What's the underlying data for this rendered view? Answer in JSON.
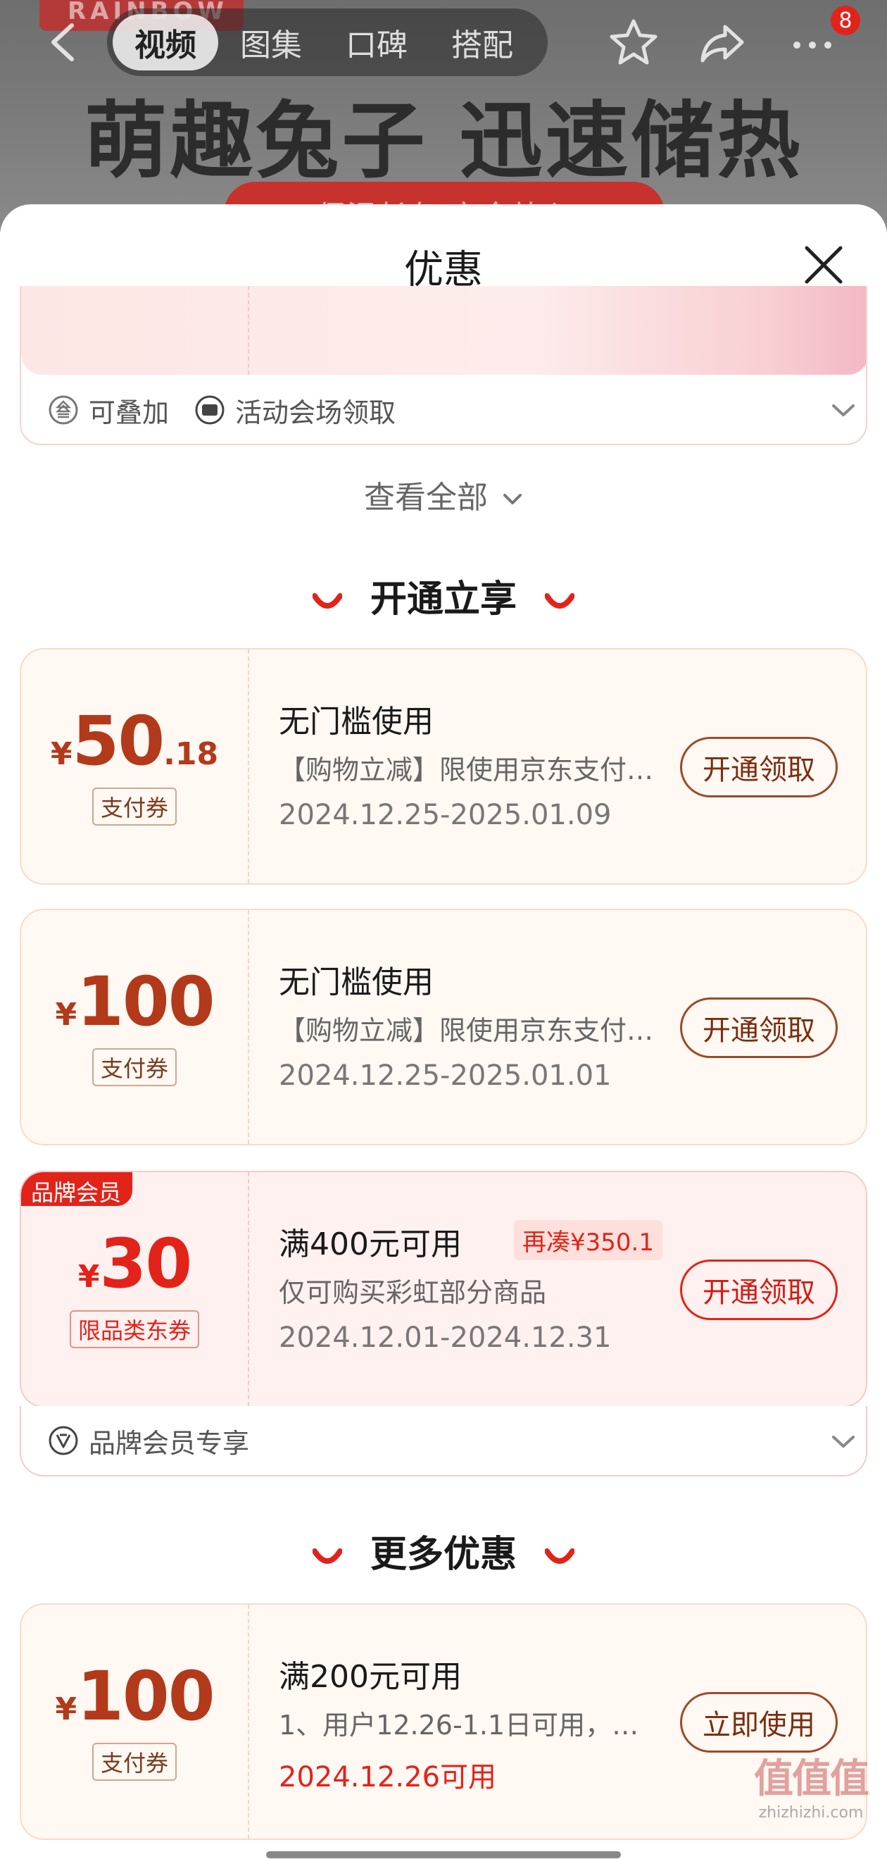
{
  "header": {
    "brand_tag": "RAINBOW",
    "tabs": [
      {
        "label": "视频",
        "active": true
      },
      {
        "label": "图集",
        "active": false
      },
      {
        "label": "口碑",
        "active": false
      },
      {
        "label": "搭配",
        "active": false
      }
    ],
    "icons": [
      "back-icon",
      "star-icon",
      "share-icon",
      "more-icon"
    ],
    "message_badge": "8",
    "headline": "萌趣兔子 迅速储热",
    "subheadline": "保温长久 安全放心"
  },
  "sheet": {
    "title": "优惠",
    "prev_card_tags": [
      {
        "icon": "stack-icon",
        "label": "可叠加"
      },
      {
        "icon": "ticket-icon",
        "label": "活动会场领取"
      }
    ],
    "view_all": "查看全部",
    "section1_title": "开通立享",
    "section2_title": "更多优惠",
    "coupons": [
      {
        "yen": "¥",
        "amount": "50",
        "decimal": ".18",
        "type": "支付券",
        "condition": "无门槛使用",
        "desc": "【购物立减】限使用京东支付…",
        "date": "2024.12.25-2025.01.09",
        "button": "开通领取"
      },
      {
        "yen": "¥",
        "amount": "100",
        "decimal": "",
        "type": "支付券",
        "condition": "无门槛使用",
        "desc": "【购物立减】限使用京东支付…",
        "date": "2024.12.25-2025.01.01",
        "button": "开通领取"
      },
      {
        "badge": "品牌会员",
        "yen": "¥",
        "amount": "30",
        "decimal": "",
        "type": "限品类东券",
        "condition": "满400元可用",
        "extra": "再凑¥350.1",
        "desc": "仅可购买彩虹部分商品",
        "date": "2024.12.01-2024.12.31",
        "button": "开通领取",
        "footer_icon": "member-v-icon",
        "footer": "品牌会员专享"
      },
      {
        "yen": "¥",
        "amount": "100",
        "decimal": "",
        "type": "支付券",
        "condition": "满200元可用",
        "desc": "1、用户12.26-1.1日可用，…",
        "date": "2024.12.26可用",
        "button": "立即使用"
      }
    ]
  },
  "watermark": {
    "mark": "值值值",
    "site": "zhizhizhi.com"
  },
  "colors": {
    "accent_red": "#e2231a",
    "coupon_brown": "#b23a1a",
    "card_bg": "#fff8f3",
    "member_bg": "#fff1f0"
  }
}
